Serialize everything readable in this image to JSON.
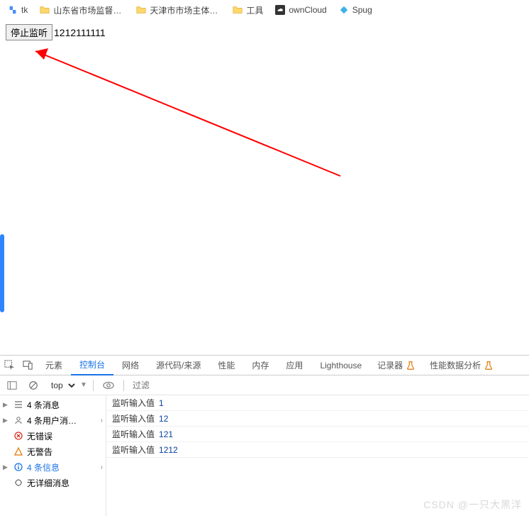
{
  "bookmarks": [
    {
      "label": "tk",
      "type": "app"
    },
    {
      "label": "山东省市场监督管…",
      "type": "folder"
    },
    {
      "label": "天津市市场主体一…",
      "type": "folder"
    },
    {
      "label": "工具",
      "type": "folder"
    },
    {
      "label": "ownCloud",
      "type": "owncloud"
    },
    {
      "label": "Spug",
      "type": "spug"
    }
  ],
  "page": {
    "button_label": "停止监听",
    "input_value": "1212111111"
  },
  "devtools": {
    "tabs": [
      "元素",
      "控制台",
      "网络",
      "源代码/来源",
      "性能",
      "内存",
      "应用",
      "Lighthouse"
    ],
    "extra_tabs": [
      {
        "label": "记录器",
        "flask": true
      },
      {
        "label": "性能数据分析",
        "flask": true
      }
    ],
    "active_tab": "控制台",
    "toolbar": {
      "context": "top",
      "filter_placeholder": "过滤"
    },
    "sidebar": [
      {
        "caret": true,
        "icon": "list",
        "label": "4 条消息",
        "pin": false
      },
      {
        "caret": true,
        "icon": "user",
        "label": "4 条用户消…",
        "pin": true
      },
      {
        "caret": false,
        "icon": "error",
        "label": "无错误",
        "pin": false
      },
      {
        "caret": false,
        "icon": "warn",
        "label": "无警告",
        "pin": false
      },
      {
        "caret": true,
        "icon": "info",
        "label": "4 条信息",
        "pin": true
      },
      {
        "caret": false,
        "icon": "debug",
        "label": "无详细消息",
        "pin": false
      }
    ],
    "console_rows": [
      {
        "label": "监听输入值",
        "value": "1"
      },
      {
        "label": "监听输入值",
        "value": "12"
      },
      {
        "label": "监听输入值",
        "value": "121"
      },
      {
        "label": "监听输入值",
        "value": "1212"
      }
    ]
  },
  "watermark": "CSDN @一只大黑洋"
}
